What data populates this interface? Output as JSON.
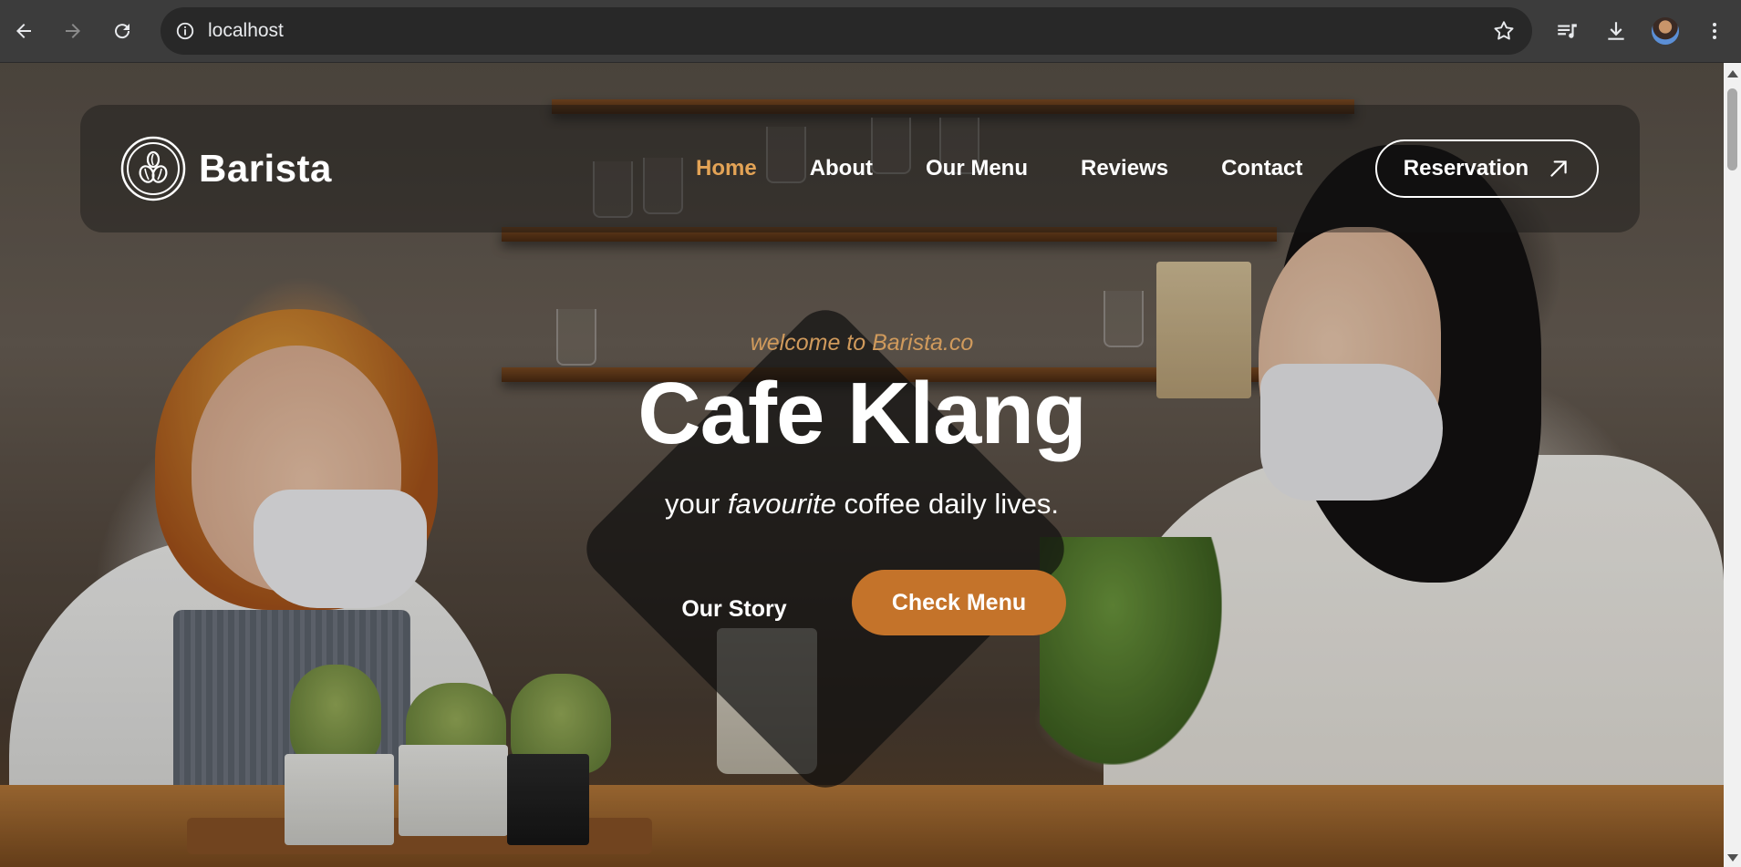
{
  "browser": {
    "url": "localhost",
    "icons": {
      "back": "arrow-left-icon",
      "forward": "arrow-right-icon",
      "reload": "reload-icon",
      "site_info": "info-icon",
      "bookmark": "star-icon",
      "media": "media-control-icon",
      "downloads": "download-icon",
      "profile": "avatar",
      "menu": "kebab-menu-icon"
    }
  },
  "site": {
    "brand": "Barista",
    "nav": [
      {
        "label": "Home",
        "active": true
      },
      {
        "label": "About",
        "active": false
      },
      {
        "label": "Our Menu",
        "active": false
      },
      {
        "label": "Reviews",
        "active": false
      },
      {
        "label": "Contact",
        "active": false
      }
    ],
    "reservation_label": "Reservation",
    "accent_color": "#e3a356",
    "button_color": "#c4732a"
  },
  "hero": {
    "welcome": "welcome to Barista.co",
    "title": "Cafe Klang",
    "tagline_before": "your ",
    "tagline_emphasis": "favourite",
    "tagline_after": " coffee daily lives.",
    "story_button": "Our Story",
    "menu_button": "Check Menu"
  }
}
